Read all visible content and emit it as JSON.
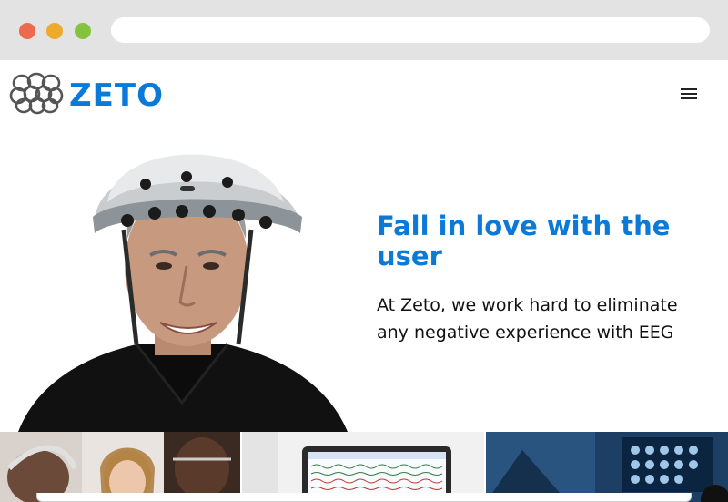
{
  "browser": {
    "traffic_lights": [
      "close",
      "minimize",
      "maximize"
    ],
    "colors": {
      "close": "#ec6a4e",
      "minimize": "#eeaa2c",
      "maximize": "#84c340"
    }
  },
  "header": {
    "logo_text": "ZETO",
    "menu_icon": "hamburger-menu-icon"
  },
  "hero": {
    "title": "Fall in love with the user",
    "body": "At Zeto, we work hard to eliminate any negative experience with EEG"
  },
  "thumbnails": [
    "clinicians-photo",
    "eeg-tablet-photo",
    "eeg-monitor-photo"
  ],
  "colors": {
    "brand": "#0a79d8",
    "text": "#111111"
  }
}
